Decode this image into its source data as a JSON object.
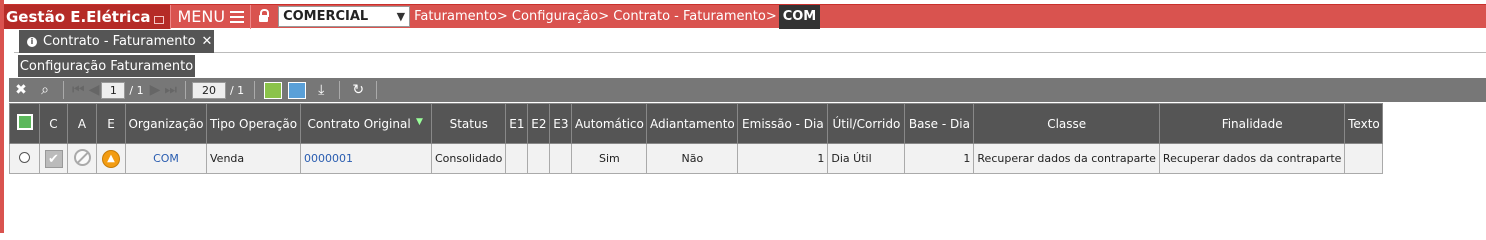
{
  "app": {
    "title": "Gestão E.Elétrica",
    "menu_label": "MENU"
  },
  "company_select": {
    "value": "COMERCIAL"
  },
  "breadcrumb": {
    "path": "Faturamento> Configuração> Contrato - Faturamento>",
    "current": "COM"
  },
  "tabs": {
    "document_tab": "Contrato - Faturamento",
    "close_glyph": "✕"
  },
  "subtab": {
    "label": "Configuração Faturamento"
  },
  "toolbar": {
    "page_current": "1",
    "page_total": "/ 1",
    "page_size": "20",
    "size_total": "/ 1",
    "icons": [
      "tools-icon",
      "search-icon",
      "first-page-icon",
      "prev-page-icon",
      "next-page-icon",
      "last-page-icon",
      "import-icon",
      "export-icon",
      "download-icon",
      "refresh-icon"
    ]
  },
  "grid": {
    "headers": {
      "c": "C",
      "a": "A",
      "e": "E",
      "organizacao": "Organização",
      "tipo_operacao": "Tipo Operação",
      "contrato_original": "Contrato Original",
      "status": "Status",
      "e1": "E1",
      "e2": "E2",
      "e3": "E3",
      "automatico": "Automático",
      "adiantamento": "Adiantamento",
      "emissao_dia": "Emissão - Dia",
      "util_corrido": "Útil/Corrido",
      "base_dia": "Base - Dia",
      "classe": "Classe",
      "finalidade": "Finalidade",
      "texto": "Texto"
    },
    "rows": [
      {
        "organizacao": "COM",
        "tipo_operacao": "Venda",
        "contrato_original": "0000001",
        "status": "Consolidado",
        "e1": "",
        "e2": "",
        "e3": "",
        "automatico": "Sim",
        "adiantamento": "Não",
        "emissao_dia": "1",
        "util_corrido": "Dia Útil",
        "base_dia": "1",
        "classe": "Recuperar dados da contraparte",
        "finalidade": "Recuperar dados da contraparte",
        "texto": ""
      }
    ]
  },
  "colors": {
    "accent": "#d9534f",
    "header_bg": "#555555",
    "toolbar_bg": "#777777",
    "link": "#2a5db0"
  }
}
